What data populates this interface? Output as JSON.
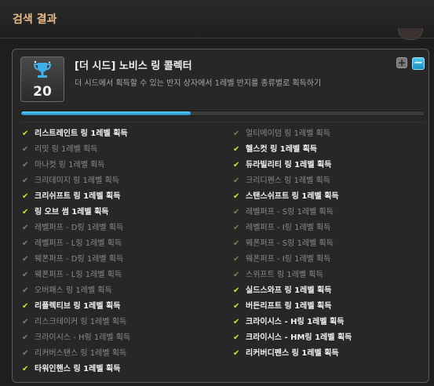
{
  "header": {
    "title": "검색 결과"
  },
  "achievement": {
    "level": "20",
    "title": "[더 시드] 노비스 링 콜렉터",
    "description": "더 시드에서 획득할 수 있는 반지 상자에서 1레벨 반지를 종류별로 획득하기",
    "progress_fraction": 0.42
  },
  "colors": {
    "accent": "#2aa6e0",
    "done_check": "#d6e23a",
    "header_text": "#e9b98a"
  },
  "items_left": [
    {
      "label": "리스트레인트 링 1레벨 획득",
      "done": true
    },
    {
      "label": "리밋 링 1레벨 획득",
      "done": false
    },
    {
      "label": "마나컷 링 1레벨 획득",
      "done": false
    },
    {
      "label": "크리데미지 링 1레벨 획득",
      "done": false
    },
    {
      "label": "크리쉬프트 링 1레벨 획득",
      "done": true
    },
    {
      "label": "링 오브 썸 1레벨 획득",
      "done": true
    },
    {
      "label": "레벨퍼프 - D링 1레벨 획득",
      "done": false
    },
    {
      "label": "레벨퍼프 - L링 1레벨 획득",
      "done": false
    },
    {
      "label": "웨폰퍼프 - D링 1레벨 획득",
      "done": false
    },
    {
      "label": "웨폰퍼프 - L링 1레벨 획득",
      "done": false
    },
    {
      "label": "오버패스 링 1레벨 획득",
      "done": false
    },
    {
      "label": "리플렉티브 링 1레벨 획득",
      "done": true
    },
    {
      "label": "리스크테이커 링 1레벨 획득",
      "done": false
    },
    {
      "label": "크라이시스 - H링 1레벨 획득",
      "done": false
    },
    {
      "label": "리커버스탠스 링 1레벨 획득",
      "done": false
    },
    {
      "label": "타워인핸스 링 1레벨 획득",
      "done": true
    }
  ],
  "items_right": [
    {
      "label": "얼티메이덤 링 1레벨 획득",
      "done": false
    },
    {
      "label": "헬스컷 링 1레벨 획득",
      "done": true
    },
    {
      "label": "듀라빌리티 링 1레벨 획득",
      "done": true
    },
    {
      "label": "크리디펜스 링 1레벨 획득",
      "done": false
    },
    {
      "label": "스탠스쉬프트 링 1레벨 획득",
      "done": true
    },
    {
      "label": "레벨퍼프 - S링 1레벨 획득",
      "done": false
    },
    {
      "label": "레벨퍼프 - I링 1레벨 획득",
      "done": false
    },
    {
      "label": "웨폰퍼프 - S링 1레벨 획득",
      "done": false
    },
    {
      "label": "웨폰퍼프 - I링 1레벨 획득",
      "done": false
    },
    {
      "label": "스위프트 링 1레벨 획득",
      "done": false
    },
    {
      "label": "실드스와프 링 1레벨 획득",
      "done": true
    },
    {
      "label": "버든리프트 링 1레벨 획득",
      "done": true
    },
    {
      "label": "크라이시스 - H링 1레벨 획득",
      "done": true
    },
    {
      "label": "크라이시스 - HM링 1레벨 획득",
      "done": true
    },
    {
      "label": "리커버디펜스 링 1레벨 획득",
      "done": true
    }
  ],
  "check_glyph": "✔"
}
